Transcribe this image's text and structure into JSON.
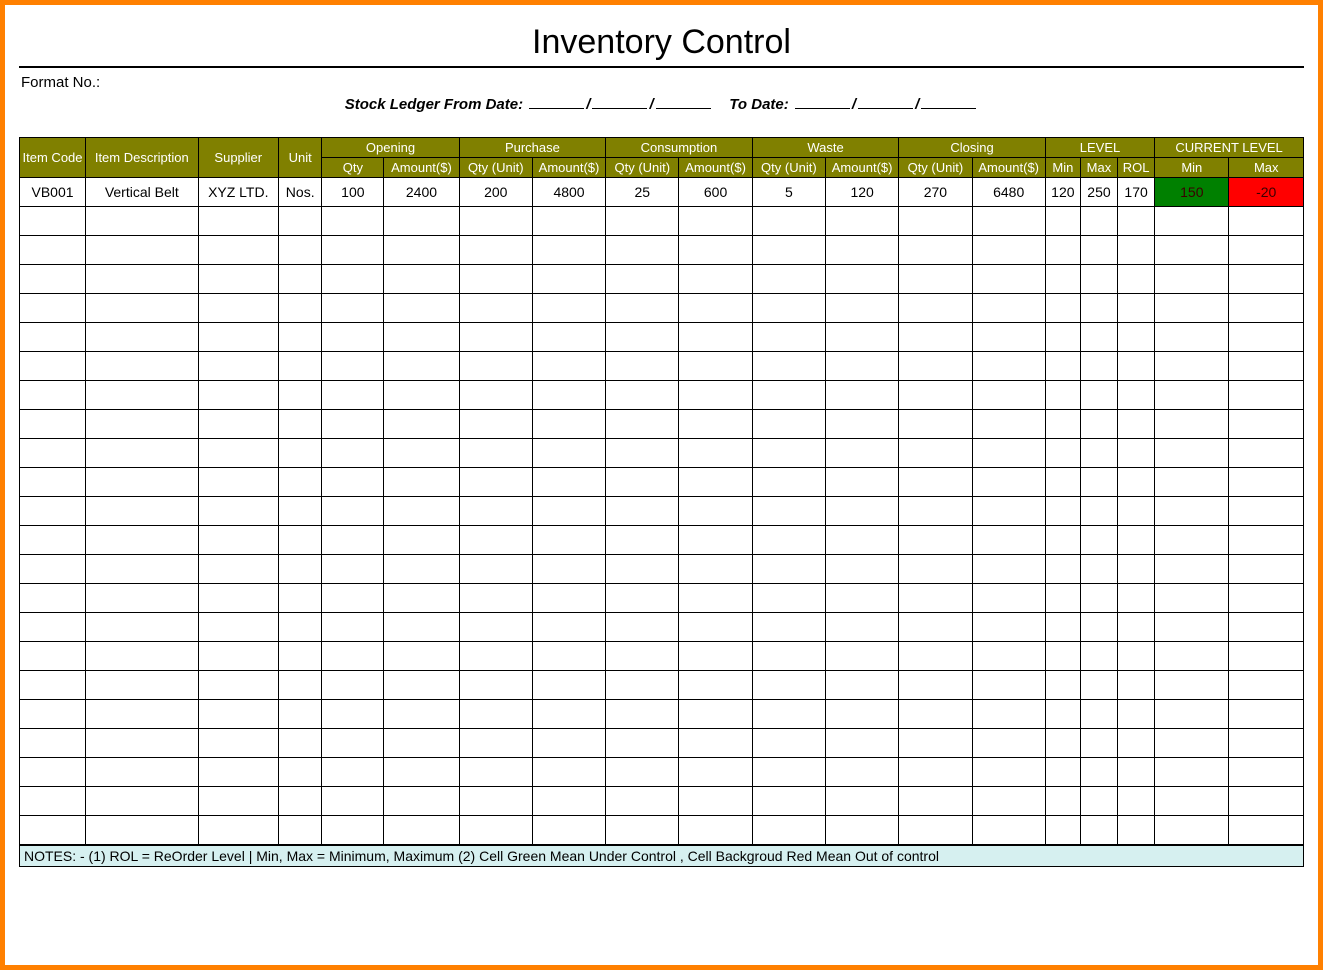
{
  "title": "Inventory Control",
  "format_label": "Format No.:",
  "ledger_from_label": "Stock Ledger From Date:",
  "ledger_to_label": "To Date:",
  "columns": {
    "item_code": "Item Code",
    "item_desc": "Item Description",
    "supplier": "Supplier",
    "unit": "Unit",
    "opening": "Opening",
    "purchase": "Purchase",
    "consumption": "Consumption",
    "waste": "Waste",
    "closing": "Closing",
    "level": "LEVEL",
    "current_level": "CURRENT LEVEL",
    "qty": "Qty",
    "amount": "Amount($)",
    "qty_unit": "Qty (Unit)",
    "min": "Min",
    "max": "Max",
    "rol": "ROL"
  },
  "rows": [
    {
      "item_code": "VB001",
      "item_desc": "Vertical Belt",
      "supplier": "XYZ LTD.",
      "unit": "Nos.",
      "opening_qty": "100",
      "opening_amt": "2400",
      "purchase_qty": "200",
      "purchase_amt": "4800",
      "consumption_qty": "25",
      "consumption_amt": "600",
      "waste_qty": "5",
      "waste_amt": "120",
      "closing_qty": "270",
      "closing_amt": "6480",
      "level_min": "120",
      "level_max": "250",
      "level_rol": "170",
      "current_min": "150",
      "current_max": "-20",
      "current_min_status": "green",
      "current_max_status": "red"
    }
  ],
  "empty_row_count": 22,
  "notes": "NOTES: - (1) ROL = ReOrder Level | Min, Max = Minimum, Maximum     (2) Cell Green Mean Under Control , Cell Backgroud Red Mean Out of control"
}
